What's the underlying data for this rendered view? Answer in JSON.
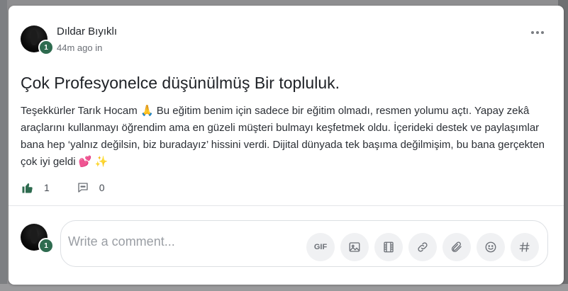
{
  "post": {
    "author": "Dıldar Bıyıklı",
    "level": "1",
    "time": "44m ago",
    "location": "in",
    "title": "Çok Profesyonelce düşünülmüş Bir topluluk.",
    "body": "Teşekkürler Tarık Hocam 🙏 Bu eğitim benim için sadece bir eğitim olmadı, resmen yolumu açtı. Yapay zekâ araçlarını kullanmayı öğrendim ama en güzeli müşteri bulmayı keşfetmek oldu. İçerideki destek ve paylaşımlar bana hep ‘yalnız değilsin, biz buradayız’ hissini verdi. Dijital dünyada tek başıma değilmişim, bu bana gerçekten çok iyi geldi 💕 ✨",
    "likes": "1",
    "comments": "0"
  },
  "composer": {
    "placeholder": "Write a comment...",
    "level": "1",
    "gif_label": "GIF"
  },
  "colors": {
    "accent": "#2e6b4f",
    "title": "#1e2126",
    "muted": "#6b6f76"
  },
  "icons": [
    "more-icon",
    "thumbs-up-icon",
    "comment-icon",
    "gif-icon",
    "image-icon",
    "video-icon",
    "link-icon",
    "attachment-icon",
    "emoji-icon",
    "hashtag-icon"
  ]
}
